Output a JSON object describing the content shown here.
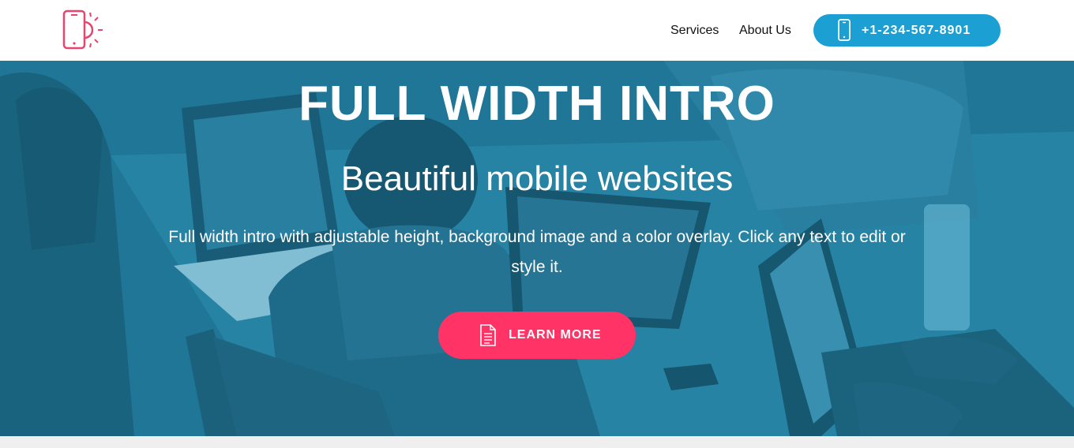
{
  "header": {
    "logo_icon": "phone-sun-logo-icon",
    "nav": [
      {
        "label": "Services"
      },
      {
        "label": "About Us"
      }
    ],
    "phone_button": {
      "icon": "mobile-phone-icon",
      "label": "+1-234-567-8901"
    }
  },
  "hero": {
    "title": "FULL WIDTH INTRO",
    "subtitle": "Beautiful mobile websites",
    "text": "Full width intro with adjustable height, background image and a color overlay. Click any text to edit or style it.",
    "cta": {
      "icon": "document-icon",
      "label": "LEARN MORE"
    }
  },
  "colors": {
    "accent_blue": "#1c9fd3",
    "accent_pink": "#ff3366",
    "logo_pink": "#e8446f",
    "overlay": "#2296be",
    "nav_text": "#111111",
    "footer_strip": "#efefef"
  }
}
